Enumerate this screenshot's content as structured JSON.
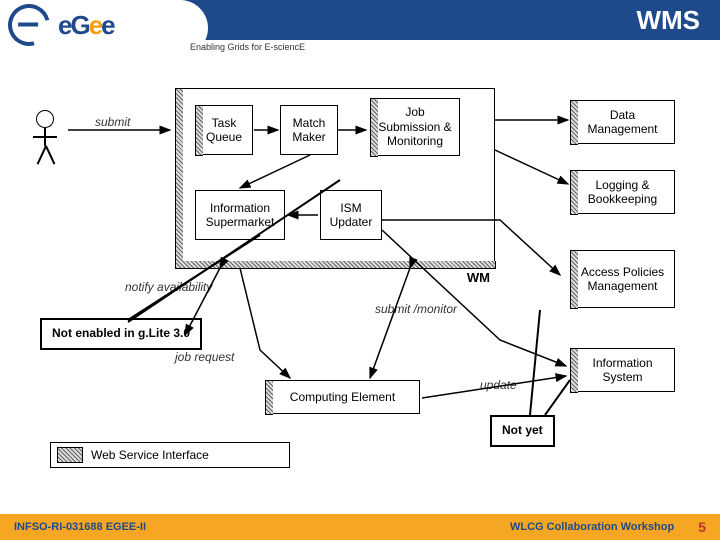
{
  "header": {
    "title": "WMS",
    "tagline": "Enabling Grids for E-sciencE",
    "logo_text": "eGee"
  },
  "diagram": {
    "wm_label": "WM",
    "boxes": {
      "task_queue": "Task\nQueue",
      "match_maker": "Match\nMaker",
      "job_sub": "Job\nSubmission\n& Monitoring",
      "info_super": "Information\nSupermarket",
      "ism_updater": "ISM\nUpdater",
      "data_mgmt": "Data\nManagement",
      "logging": "Logging\n& Bookkeeping",
      "access": "Access\nPolicies\nManagement",
      "info_sys": "Information\nSystem",
      "compute": "Computing Element"
    },
    "labels": {
      "submit": "submit",
      "notify": "notify\navailability",
      "job_request": "job request",
      "submit_monitor": "submit\n/monitor",
      "update": "update"
    },
    "callouts": {
      "not_enabled": "Not enabled\nin g.Lite 3.0",
      "not_yet": "Not yet"
    },
    "legend": "Web Service Interface"
  },
  "footer": {
    "left": "INFSO-RI-031688 EGEE-II",
    "right": "WLCG Collaboration Workshop",
    "page": "5"
  }
}
